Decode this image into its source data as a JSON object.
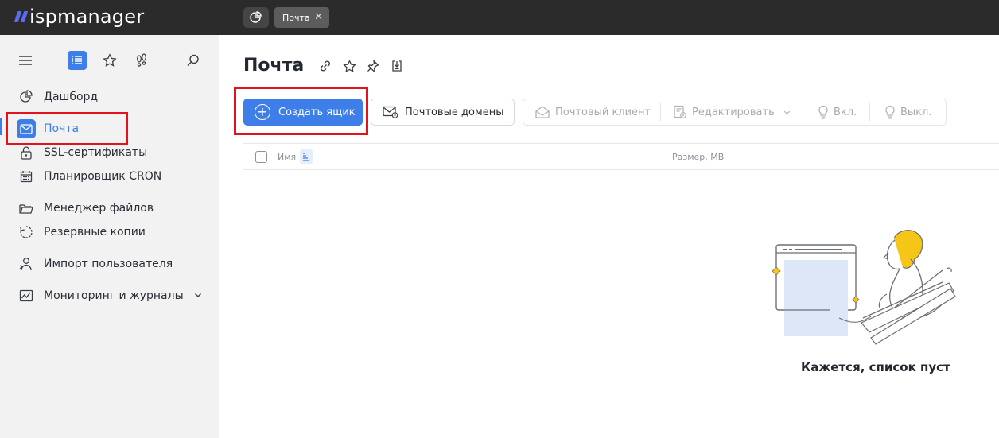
{
  "app": {
    "logo_text": "ispmanager",
    "accent": "#3d7ee8",
    "highlight": "#e3131d"
  },
  "tabs": [
    {
      "label": "",
      "icon": "dashboard-icon"
    },
    {
      "label": "Почта",
      "icon": "close-icon"
    }
  ],
  "sidebar": {
    "tools": [
      "menu-icon",
      "list-icon",
      "star-icon",
      "footprints-icon",
      "search-icon"
    ],
    "items": [
      {
        "label": "Дашборд",
        "icon": "pie-chart-icon"
      },
      {
        "label": "Почта",
        "icon": "mail-icon",
        "active": true
      },
      {
        "label": "SSL-сертификаты",
        "icon": "lock-icon"
      },
      {
        "label": "Планировщик CRON",
        "icon": "calendar-icon"
      },
      {
        "label": "Менеджер файлов",
        "icon": "folder-icon"
      },
      {
        "label": "Резервные копии",
        "icon": "backup-icon"
      },
      {
        "label": "Импорт пользователя",
        "icon": "user-import-icon"
      },
      {
        "label": "Мониторинг и журналы",
        "icon": "monitoring-icon"
      }
    ]
  },
  "main": {
    "title": "Почта",
    "title_icons": [
      "link-icon",
      "star-icon",
      "pin-icon",
      "download-icon"
    ],
    "toolbar": {
      "create": "Создать ящик",
      "domains": "Почтовые домены",
      "client": "Почтовый клиент",
      "edit": "Редактировать",
      "enable": "Вкл.",
      "disable": "Выкл."
    },
    "table": {
      "col_name": "Имя",
      "col_size": "Размер, MB"
    },
    "empty_text": "Кажется, список пуст"
  }
}
